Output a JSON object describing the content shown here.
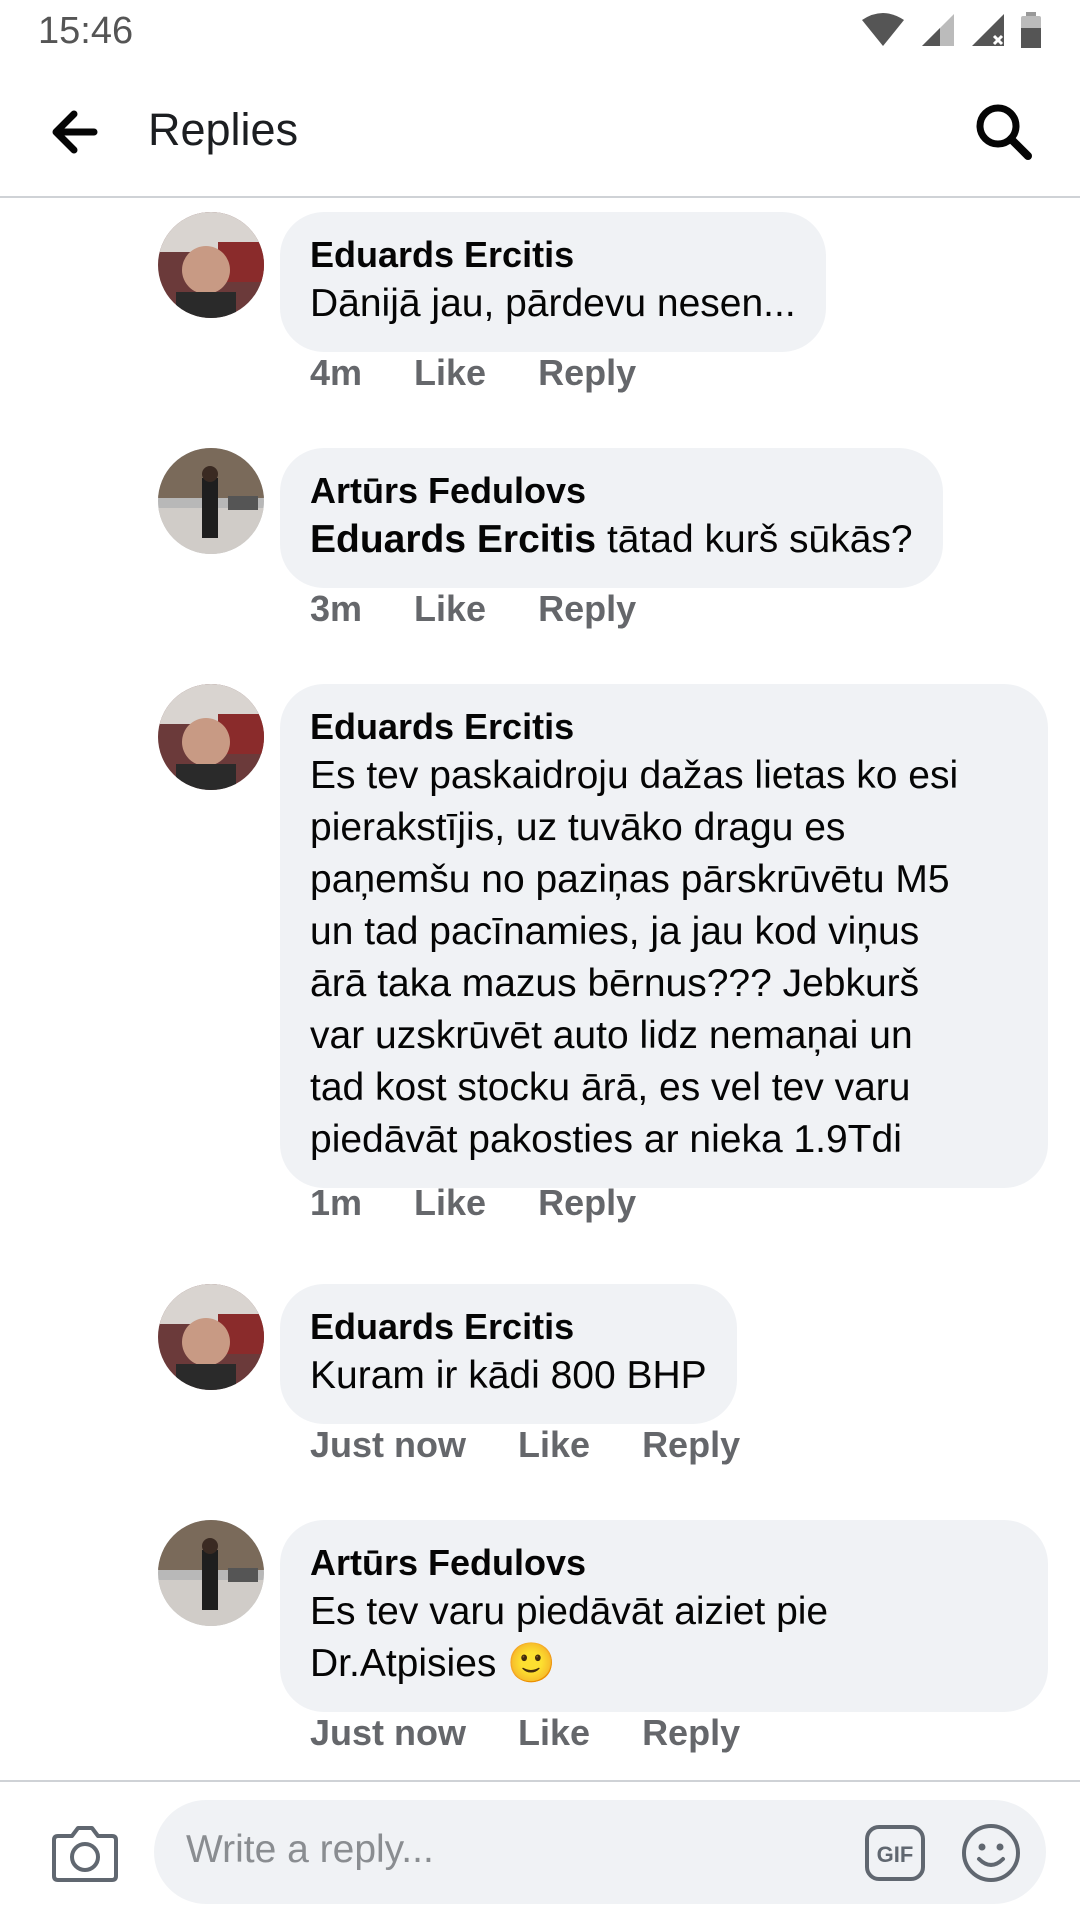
{
  "status_bar": {
    "time": "15:46"
  },
  "header": {
    "title": "Replies"
  },
  "comments": [
    {
      "author": "Eduards Ercitis",
      "text": "Dānijā jau, pārdevu nesen...",
      "time": "4m",
      "like": "Like",
      "reply": "Reply"
    },
    {
      "author": "Artūrs Fedulovs",
      "mention": "Eduards Ercitis",
      "text": " tātad kurš sūkās?",
      "time": "3m",
      "like": "Like",
      "reply": "Reply"
    },
    {
      "author": "Eduards Ercitis",
      "lines": [
        "Es tev paskaidroju dažas lietas ko esi",
        "pierakstījis, uz tuvāko dragu es",
        "paņemšu no paziņas pārskrūvētu M5",
        "un tad pacīnamies, ja jau kod viņus",
        "ārā taka mazus bērnus??? Jebkurš",
        "var uzskrūvēt auto lidz nemaņai un",
        "tad kost stocku ārā, es vel tev varu",
        "piedāvāt pakosties ar nieka 1.9Tdi"
      ],
      "time": "1m",
      "like": "Like",
      "reply": "Reply"
    },
    {
      "author": "Eduards Ercitis",
      "text": "Kuram ir kādi 800 BHP",
      "time": "Just now",
      "like": "Like",
      "reply": "Reply"
    },
    {
      "author": "Artūrs Fedulovs",
      "lines": [
        "Es tev varu piedāvāt aiziet pie",
        "Dr.Atpisies"
      ],
      "emoji": "🙂",
      "time": "Just now",
      "like": "Like",
      "reply": "Reply"
    }
  ],
  "composer": {
    "placeholder": "Write a reply...",
    "gif_label": "GIF"
  },
  "icons": {
    "back": "arrow-left-icon",
    "search": "search-icon",
    "camera": "camera-icon",
    "gif": "gif-icon",
    "emoji": "smiley-icon"
  }
}
